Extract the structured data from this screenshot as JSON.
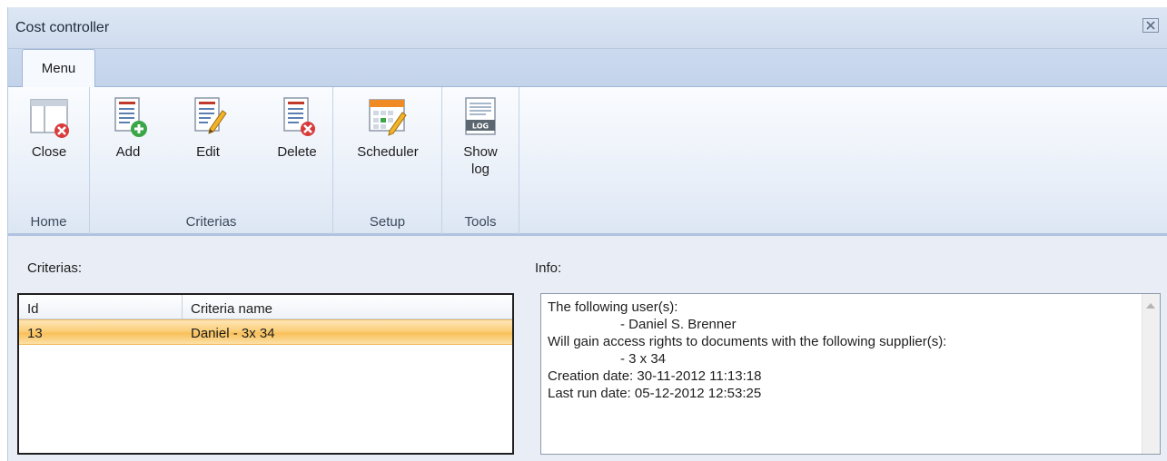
{
  "window": {
    "title": "Cost controller",
    "close_icon": "close-x-icon"
  },
  "tabs": [
    {
      "label": "Menu",
      "active": true
    }
  ],
  "ribbon": {
    "groups": [
      {
        "label": "Home",
        "buttons": [
          {
            "label": "Close",
            "icon": "close-window-icon"
          }
        ]
      },
      {
        "label": "Criterias",
        "buttons": [
          {
            "label": "Add",
            "icon": "add-document-icon"
          },
          {
            "label": "Edit",
            "icon": "edit-document-icon"
          },
          {
            "label": "Delete",
            "icon": "delete-document-icon"
          }
        ]
      },
      {
        "label": "Setup",
        "buttons": [
          {
            "label": "Scheduler",
            "icon": "scheduler-calendar-icon"
          }
        ]
      },
      {
        "label": "Tools",
        "buttons": [
          {
            "label_line1": "Show",
            "label_line2": "log",
            "icon": "log-document-icon"
          }
        ]
      }
    ]
  },
  "criterias_panel": {
    "label": "Criterias:",
    "columns": [
      "Id",
      "Criteria name"
    ],
    "rows": [
      {
        "id": "13",
        "name": "Daniel - 3x 34",
        "selected": true
      }
    ]
  },
  "info_panel": {
    "label": "Info:",
    "lines": [
      "The following user(s):",
      "- Daniel S. Brenner",
      "Will gain access rights to documents with the following supplier(s):",
      "- 3 x 34",
      "Creation date: 30-11-2012 11:13:18",
      "Last run date: 05-12-2012 12:53:25"
    ]
  },
  "colors": {
    "ribbon_background": "#e7eef8",
    "selected_row": "#f9c05a",
    "window_background": "#e9eef6"
  }
}
